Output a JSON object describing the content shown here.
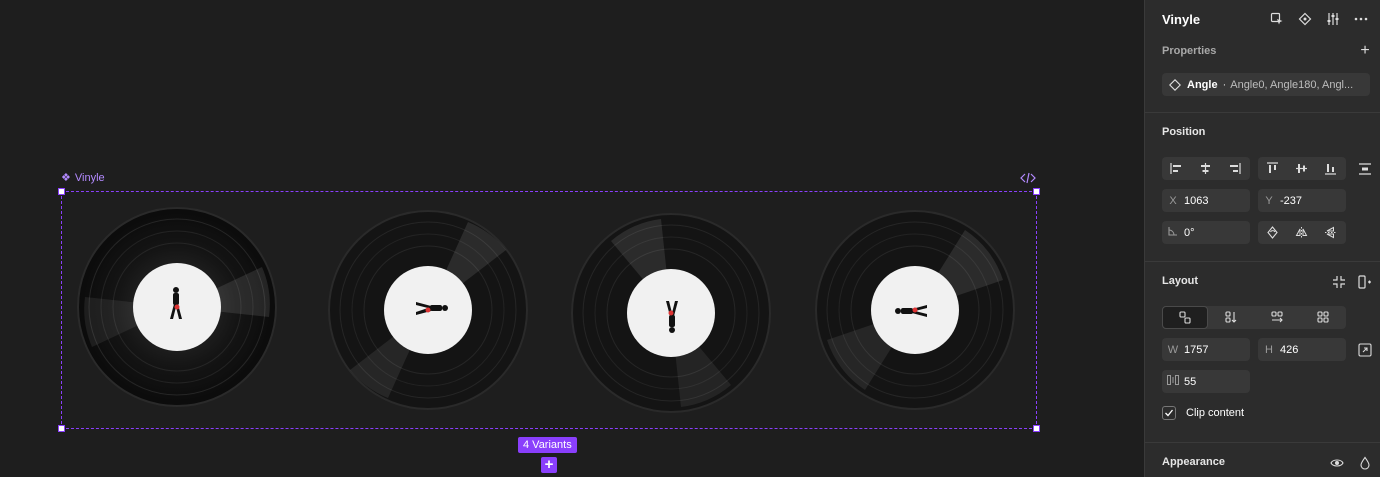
{
  "canvas": {
    "frame_label": "Vinyle",
    "variants_badge": "4 Variants",
    "add_variant_glyph": "+",
    "accent": "#8a3ffc"
  },
  "panel": {
    "title": "Vinyle",
    "properties": {
      "label": "Properties",
      "add_glyph": "+",
      "prop_name": "Angle",
      "prop_separator": "·",
      "prop_values": "Angle0, Angle180, Angl..."
    },
    "position": {
      "label": "Position",
      "x_label": "X",
      "x_value": "1063",
      "y_label": "Y",
      "y_value": "-237",
      "rotation_value": "0°"
    },
    "layout": {
      "label": "Layout",
      "w_label": "W",
      "w_value": "1757",
      "h_label": "H",
      "h_value": "426",
      "gap_value": "55",
      "clip_label": "Clip content",
      "clip_checked": true
    },
    "appearance": {
      "label": "Appearance"
    }
  }
}
